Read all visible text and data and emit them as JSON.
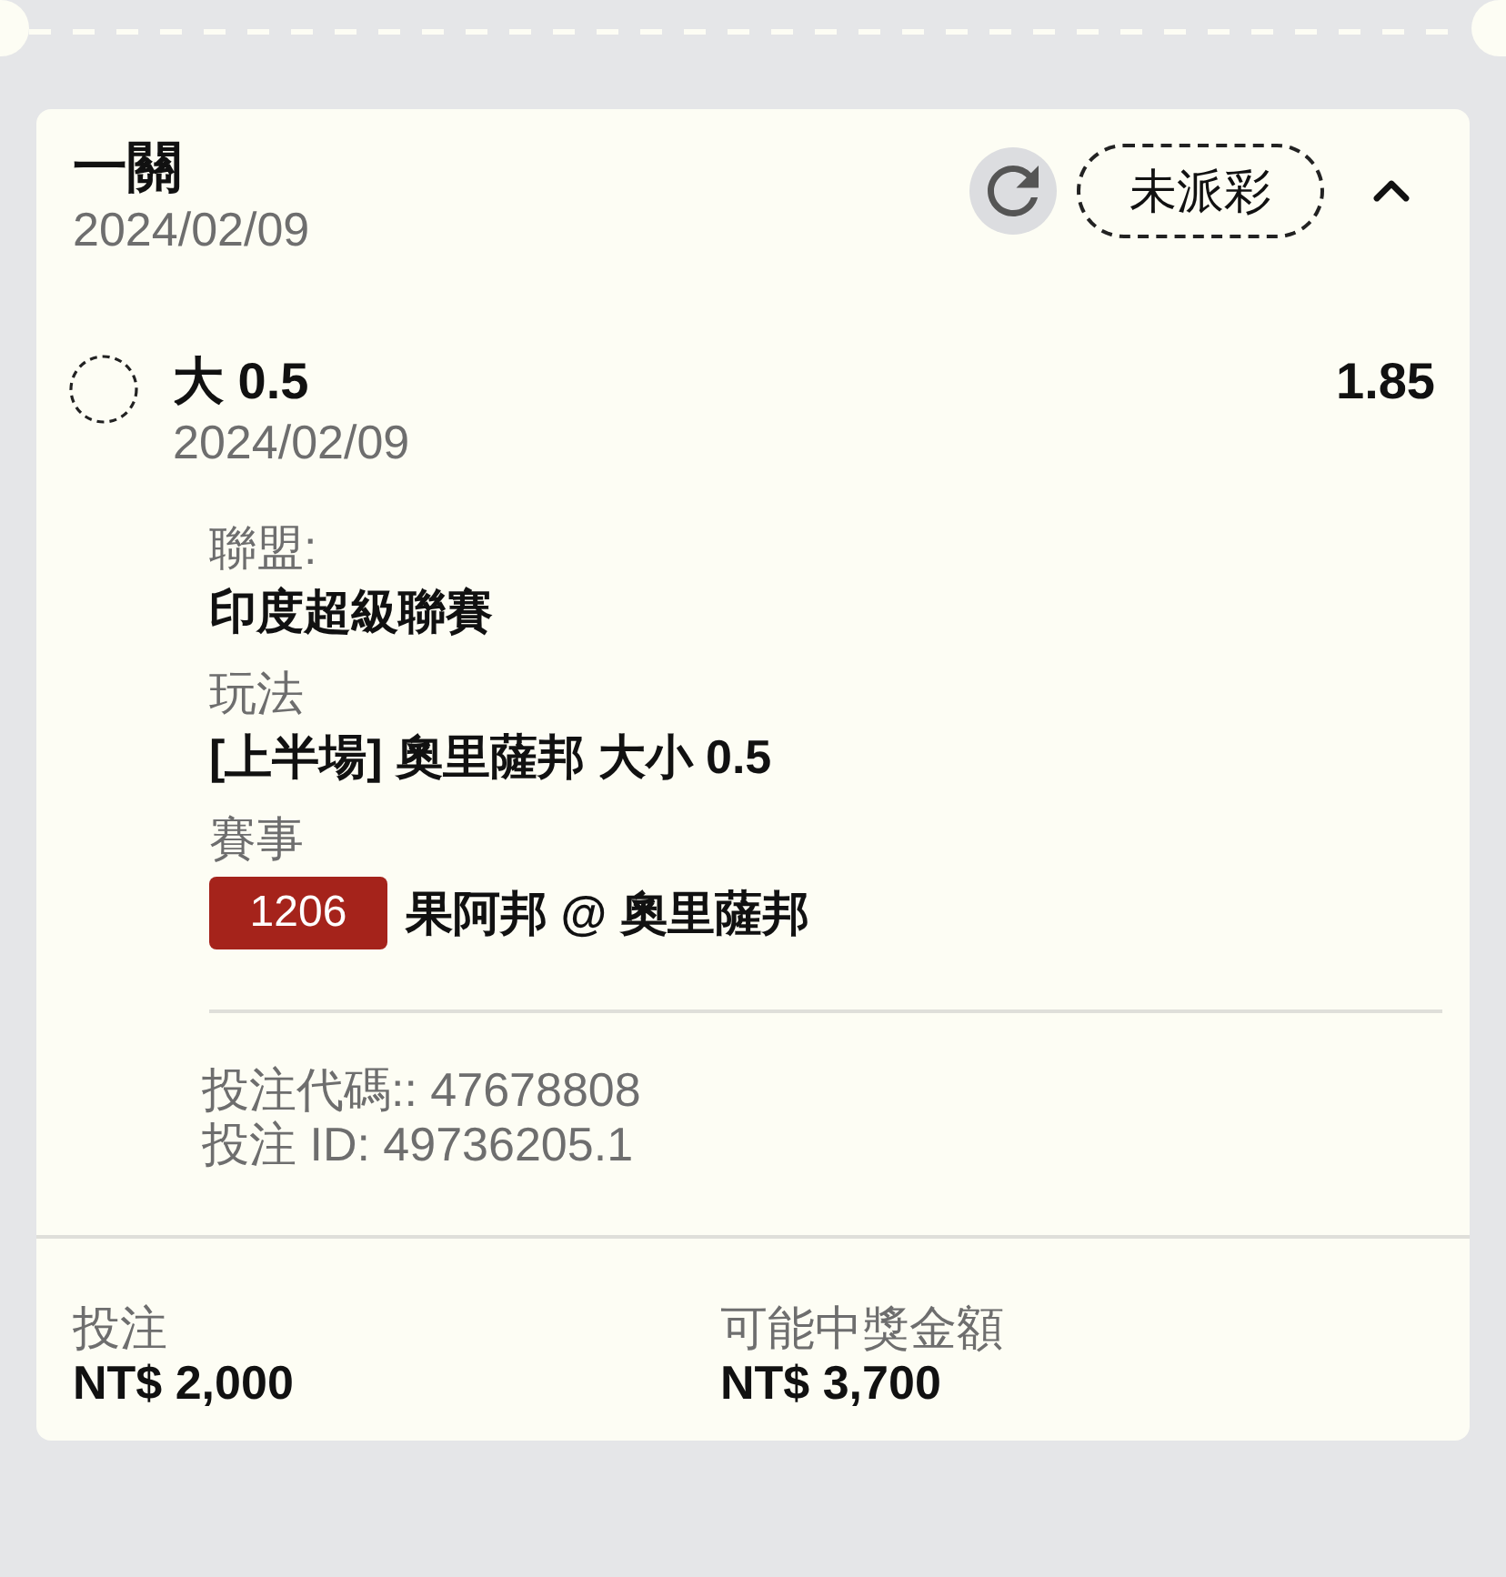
{
  "bet": {
    "title": "一關",
    "date": "2024/02/09",
    "status": "未派彩",
    "expanded": true
  },
  "selection": {
    "name": "大 0.5",
    "odds": "1.85",
    "date": "2024/02/09"
  },
  "details": [
    {
      "kind": "text",
      "label": "聯盟:",
      "value": "印度超級聯賽"
    },
    {
      "kind": "text",
      "label": "玩法",
      "value": "[上半場] 奧里薩邦 大小 0.5"
    },
    {
      "kind": "match",
      "label": "賽事",
      "number": "1206",
      "value": "果阿邦 @ 奧里薩邦"
    }
  ],
  "references": [
    "投注代碼:: 47678808",
    "投注 ID: 49736205.1"
  ],
  "summary": [
    {
      "label": "投注",
      "value": "NT$ 2,000"
    },
    {
      "label": "可能中獎金額",
      "value": "NT$ 3,700"
    }
  ]
}
